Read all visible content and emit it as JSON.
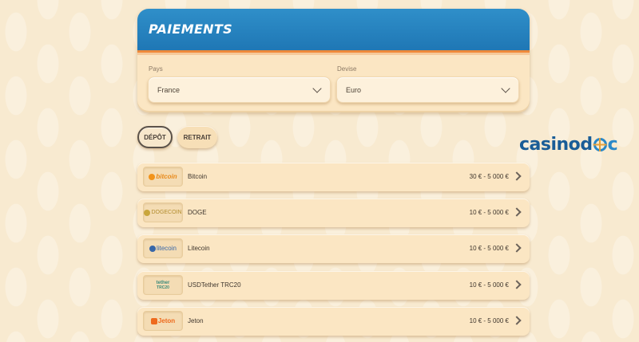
{
  "panel": {
    "title": "PAIEMENTS",
    "country_label": "Pays",
    "country_value": "France",
    "currency_label": "Devise",
    "currency_value": "Euro"
  },
  "tabs": [
    {
      "label": "DÉPÔT",
      "active": true
    },
    {
      "label": "RETRAIT",
      "active": false
    }
  ],
  "logo": {
    "part1": "casino",
    "part2": "d",
    "part3": "c"
  },
  "methods": [
    {
      "badge": "bitcoin",
      "name": "Bitcoin",
      "range": "30 € - 5 000 €"
    },
    {
      "badge": "DOGECOIN",
      "name": "DOGE",
      "range": "10 € - 5 000 €"
    },
    {
      "badge": "litecoin",
      "name": "Litecoin",
      "range": "10 € - 5 000 €"
    },
    {
      "badge": "tether",
      "badge_sub": "TRC20",
      "name": "USDTether TRC20",
      "range": "10 € - 5 000 €"
    },
    {
      "badge": "Jeton",
      "name": "Jeton",
      "range": "10 € - 5 000 €"
    }
  ],
  "colors": {
    "header_blue": "#1f77b5",
    "accent_orange": "#ee8a3a",
    "background": "#f8ead0"
  }
}
